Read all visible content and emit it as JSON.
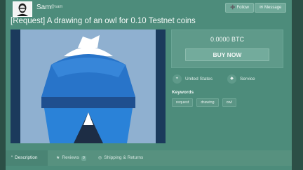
{
  "header": {
    "user_name": "Sam",
    "user_handle": "@sam",
    "follow_label": "Follow",
    "message_label": "Message"
  },
  "listing": {
    "title": "[Request] A drawing of an owl for 0.10 Testnet coins",
    "price": "0.0000 BTC",
    "buy_label": "BUY NOW",
    "location": "United States",
    "type": "Service",
    "keywords_label": "Keywords",
    "keywords": [
      "request",
      "drawing",
      "owl"
    ]
  },
  "tabs": [
    {
      "label": "Description"
    },
    {
      "label": "Reviews",
      "count": "0"
    },
    {
      "label": "Shipping & Returns"
    }
  ],
  "colors": {
    "background": "#4d8c7b",
    "panel": "#5f9a8a",
    "art_background": "#8fb0d0",
    "art_blue": "#2874c9",
    "art_dark_blue": "#1f4f8f",
    "art_navy": "#1d2d45"
  },
  "icons": {
    "follow": "user-plus-icon",
    "message": "envelope-icon",
    "location": "map-pin-icon",
    "service": "tag-icon",
    "description": "quote-icon",
    "reviews": "star-icon",
    "shipping": "globe-icon"
  }
}
